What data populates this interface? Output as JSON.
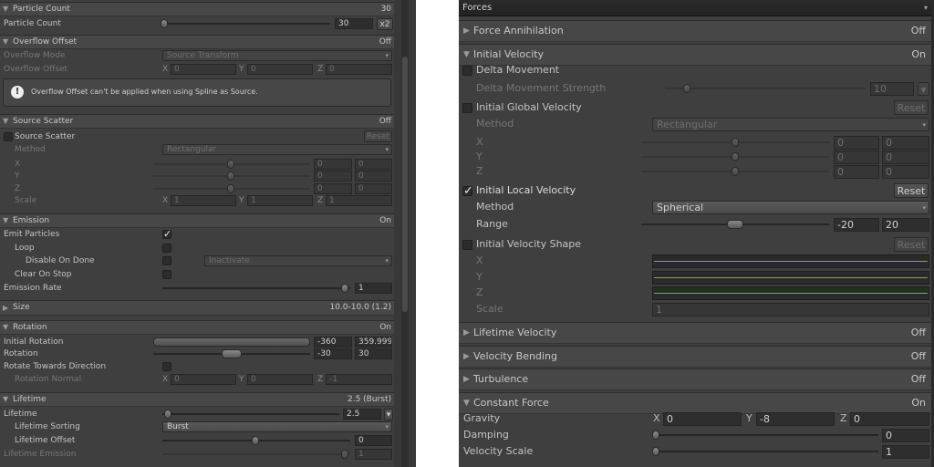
{
  "left": {
    "particle_count": {
      "header": "Particle Count",
      "header_value": "30",
      "label": "Particle Count",
      "value": "30",
      "multiplier": "x2"
    },
    "overflow": {
      "header": "Overflow Offset",
      "state": "Off",
      "mode_label": "Overflow Mode",
      "mode_value": "Source Transform",
      "offset_label": "Overflow Offset",
      "x": "0",
      "y": "0",
      "z": "0",
      "help": "Overflow Offset can't be applied when using Spline as Source."
    },
    "source_scatter": {
      "header": "Source Scatter",
      "state": "Off",
      "toggle_label": "Source Scatter",
      "reset": "Reset",
      "method_label": "Method",
      "method_value": "Rectangular",
      "x_label": "X",
      "y_label": "Y",
      "z_label": "Z",
      "x": [
        "0",
        "0"
      ],
      "y": [
        "0",
        "0"
      ],
      "z": [
        "0",
        "0"
      ],
      "scale_label": "Scale",
      "scale": [
        "1",
        "1",
        "1"
      ]
    },
    "emission": {
      "header": "Emission",
      "state": "On",
      "emit": "Emit Particles",
      "loop": "Loop",
      "disable": "Disable On Done",
      "inactivate": "Inactivate",
      "clear": "Clear On Stop",
      "rate_label": "Emission Rate",
      "rate": "1"
    },
    "size": {
      "header": "Size",
      "value": "10.0-10.0 (1.2)"
    },
    "rotation": {
      "header": "Rotation",
      "state": "On",
      "initial_label": "Initial Rotation",
      "initial": [
        "-360",
        "359.999"
      ],
      "rot_label": "Rotation",
      "rot": [
        "-30",
        "30"
      ],
      "towards": "Rotate Towards Direction",
      "normal_label": "Rotation Normal",
      "normal": [
        "0",
        "0",
        "-1"
      ]
    },
    "lifetime": {
      "header": "Lifetime",
      "value": "2.5 (Burst)",
      "lifetime_label": "Lifetime",
      "lifetime": "2.5",
      "sorting_label": "Lifetime Sorting",
      "sorting": "Burst",
      "offset_label": "Lifetime Offset",
      "offset": "0",
      "emission_label": "Lifetime Emission",
      "emission": "1"
    }
  },
  "right": {
    "title": "Forces",
    "annihilation": {
      "header": "Force Annihilation",
      "state": "Off"
    },
    "initial": {
      "header": "Initial Velocity",
      "state": "On",
      "delta": "Delta Movement",
      "delta_strength_label": "Delta Movement Strength",
      "delta_strength": "10",
      "global": "Initial Global Velocity",
      "reset": "Reset",
      "method_label": "Method",
      "global_method": "Rectangular",
      "x_label": "X",
      "y_label": "Y",
      "z_label": "Z",
      "gx": [
        "0",
        "0"
      ],
      "gy": [
        "0",
        "0"
      ],
      "gz": [
        "0",
        "0"
      ],
      "local": "Initial Local Velocity",
      "local_method": "Spherical",
      "range_label": "Range",
      "range": [
        "-20",
        "20"
      ],
      "shape": "Initial Velocity Shape",
      "scale_label": "Scale",
      "scale": "1"
    },
    "lifetime_velocity": {
      "header": "Lifetime Velocity",
      "state": "Off"
    },
    "bending": {
      "header": "Velocity Bending",
      "state": "Off"
    },
    "turbulence": {
      "header": "Turbulence",
      "state": "Off"
    },
    "constant": {
      "header": "Constant Force",
      "state": "On",
      "gravity_label": "Gravity",
      "gx": "0",
      "gy": "-8",
      "gz": "0",
      "damping_label": "Damping",
      "damping": "0",
      "vscale_label": "Velocity Scale",
      "vscale": "1"
    }
  },
  "axes": {
    "x": "X",
    "y": "Y",
    "z": "Z"
  },
  "icons": {
    "foldout_open": "▼",
    "foldout_closed": "▶",
    "dropdown": "▾",
    "warning": "!"
  }
}
